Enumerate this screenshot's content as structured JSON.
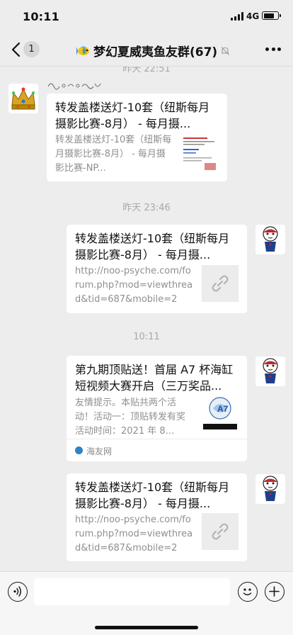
{
  "status_bar": {
    "time": "10:11",
    "network": "4G",
    "battery_level": 0.82
  },
  "nav": {
    "back_icon": "chevron-left-icon",
    "unread_count": "1",
    "title": "梦幻夏威夷鱼友群(67)",
    "title_emoji": "fish-icon",
    "mute_icon": "bell-off-icon",
    "more_icon": "more-dots-icon"
  },
  "messages": [
    {
      "type": "timestamp",
      "text": "昨天 22:51"
    },
    {
      "type": "card",
      "side": "left",
      "title": "转发盖楼送灯-10套（纽斯每月摄影比赛-8月） - 每月摄...",
      "desc": "转发盖楼送灯-10套（纽斯每月摄影比赛-8月） - 每月摄影比赛-NP...",
      "thumb": "article-thumbnail"
    },
    {
      "type": "timestamp",
      "text": "昨天 23:46"
    },
    {
      "type": "card",
      "side": "right",
      "title": "转发盖楼送灯-10套（纽斯每月摄影比赛-8月） - 每月摄...",
      "desc": "http://noo-psyche.com/forum.php?mod=viewthread&tid=687&mobile=2",
      "thumb": "link-icon"
    },
    {
      "type": "timestamp",
      "text": "10:11"
    },
    {
      "type": "card",
      "side": "right",
      "title": "第九期顶贴送！首届 A7 杯海缸短视频大赛开启（三万奖品...",
      "desc": "友情提示。本贴共两个活动！活动一：顶贴转发有奖活动时间：2021 年 8...",
      "thumb": "video-thumbnail",
      "source": "海友网"
    },
    {
      "type": "card",
      "side": "right",
      "title": "转发盖楼送灯-10套（纽斯每月摄影比赛-8月） - 每月摄...",
      "desc": "http://noo-psyche.com/forum.php?mod=viewthread&tid=687&mobile=2",
      "thumb": "link-icon"
    }
  ],
  "input_bar": {
    "voice_icon": "voice-icon",
    "emoji_icon": "emoji-icon",
    "plus_icon": "plus-icon"
  },
  "colors": {
    "background": "#ededed",
    "card": "#ffffff",
    "meta_text": "#a8a8a8"
  }
}
